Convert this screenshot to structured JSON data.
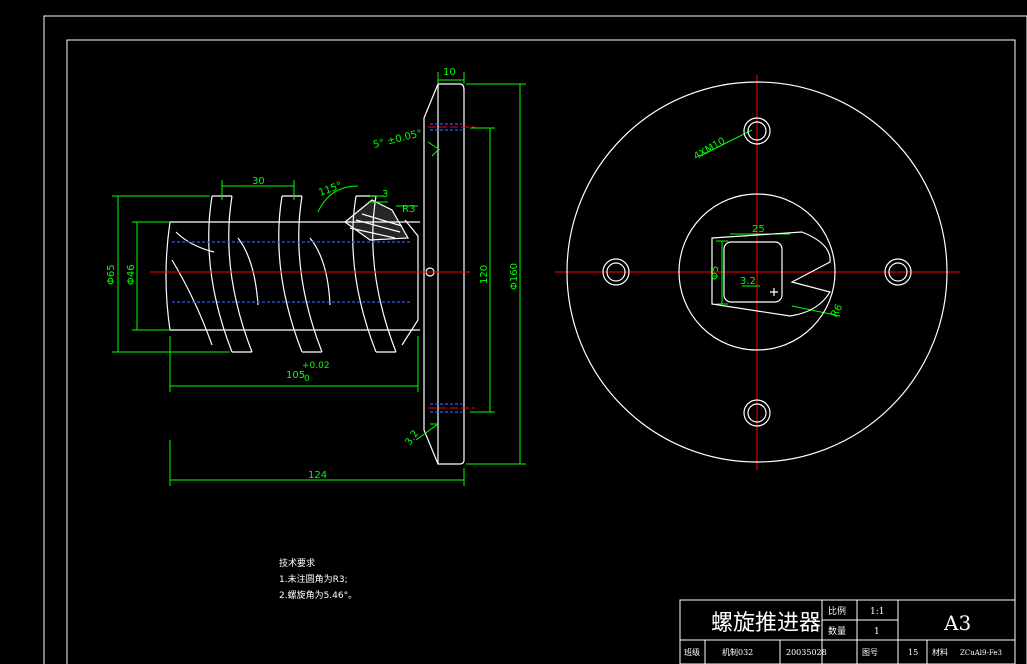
{
  "colors": {
    "background": "#000000",
    "outline": "#ffffff",
    "dimension": "#00ff00",
    "centerline": "#ff0000",
    "hidden_line": "#3355ff"
  },
  "dimensions": {
    "flange_thickness": "10",
    "chamfer": "5° ±0.05°",
    "pitch": "30",
    "thread_angle": "115°",
    "thread_depth": "3",
    "radius_tip": "R3",
    "outer_dia": "Φ65",
    "root_dia": "Φ46",
    "bolt_circle": "120",
    "flange_dia": "Φ160",
    "length_main": "105",
    "tol_upper": "+0.02",
    "tol_lower": "0",
    "total_length": "124",
    "surface_rough": "3.2",
    "holes": "4XM10",
    "hole_25": "25",
    "key_size": "Φ5",
    "key_small": "3.2",
    "radius_r": "R6"
  },
  "tech_notes": {
    "title": "技术要求",
    "line1": "1.未注圆角为R3;",
    "line2": "2.螺旋角为5.46°。"
  },
  "title_block": {
    "name": "螺旋推进器",
    "scale_label": "比例",
    "scale_value": "1:1",
    "qty_label": "数量",
    "qty_value": "1",
    "sheet": "A3",
    "class_label": "班级",
    "class_value": "机制032",
    "student_no": "20035028",
    "drawing_no_label": "图号",
    "drawing_no_value": "15",
    "material_label": "材料",
    "material_value": "ZCuAl9-Fe3"
  }
}
